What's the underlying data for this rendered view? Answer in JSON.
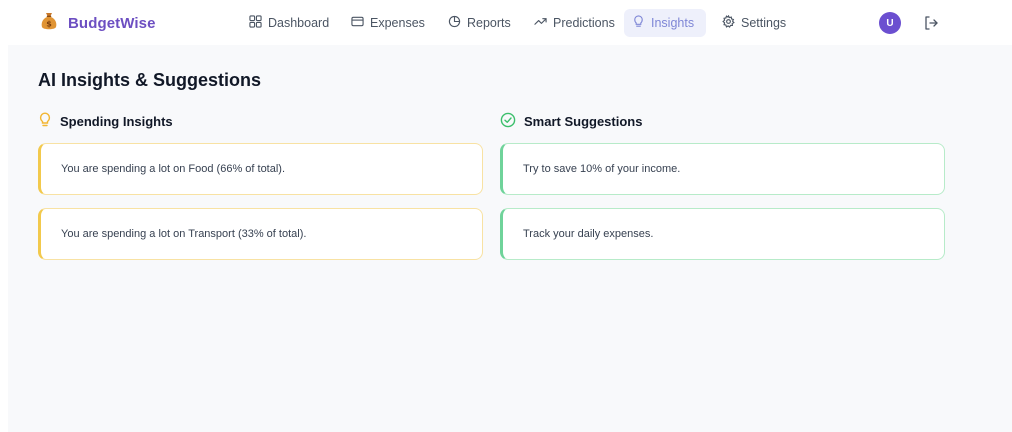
{
  "app": {
    "name": "BudgetWise",
    "logo_icon": "money-bag-icon"
  },
  "nav": {
    "items": [
      {
        "label": "Dashboard",
        "icon": "grid-icon",
        "active": false
      },
      {
        "label": "Expenses",
        "icon": "credit-card-icon",
        "active": false
      },
      {
        "label": "Reports",
        "icon": "pie-chart-icon",
        "active": false
      },
      {
        "label": "Predictions",
        "icon": "trend-up-icon",
        "active": false
      },
      {
        "label": "Insights",
        "icon": "lightbulb-icon",
        "active": true
      },
      {
        "label": "Settings",
        "icon": "gear-icon",
        "active": false
      }
    ],
    "user_initial": "U",
    "logout_icon": "logout-icon"
  },
  "page": {
    "title": "AI Insights & Suggestions",
    "insights": {
      "heading": "Spending Insights",
      "icon": "lightbulb-icon",
      "accent": "#f2c94c",
      "items": [
        "You are spending a lot on Food (66% of total).",
        "You are spending a lot on Transport (33% of total)."
      ]
    },
    "suggestions": {
      "heading": "Smart Suggestions",
      "icon": "check-circle-icon",
      "accent": "#6fd39a",
      "items": [
        "Try to save 10% of your income.",
        "Track your daily expenses."
      ]
    }
  },
  "colors": {
    "brand": "#6d4fc2",
    "active_nav_bg": "#eef0fb",
    "active_nav_text": "#7e86d6",
    "avatar": "#6b4fd0",
    "background": "#f8f9fb"
  }
}
